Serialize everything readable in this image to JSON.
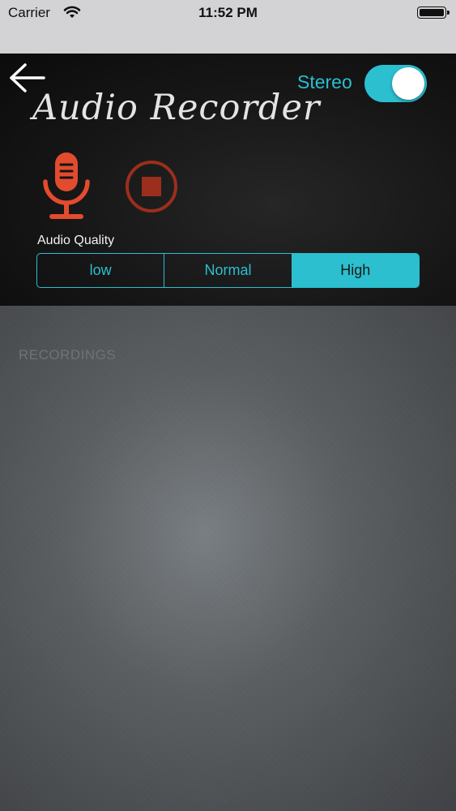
{
  "status_bar": {
    "carrier": "Carrier",
    "time": "11:52 PM",
    "battery_icon": "battery-full-icon",
    "wifi_icon": "wifi-icon"
  },
  "header": {
    "back_icon": "arrow-left-icon",
    "title": "Audio Recorder",
    "stereo": {
      "label": "Stereo",
      "enabled": true
    }
  },
  "controls": {
    "record_icon": "microphone-icon",
    "stop_icon": "stop-icon"
  },
  "quality": {
    "label": "Audio Quality",
    "options": [
      "low",
      "Normal",
      "High"
    ],
    "selected": "High"
  },
  "recordings": {
    "header": "RECORDINGS",
    "items": []
  },
  "colors": {
    "accent": "#2bbfd0",
    "record": "#e34b2e",
    "stop": "#9b2e1d"
  }
}
